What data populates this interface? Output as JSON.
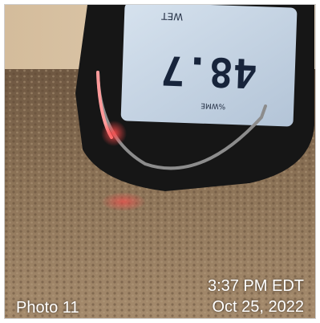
{
  "photo": {
    "label": "Photo 11",
    "time": "3:37 PM EDT",
    "date": "Oct 25, 2022",
    "meter_reading": "48.7",
    "meter_top_text": "WET",
    "meter_unit_text": "%WME"
  },
  "colors": {
    "carpet": "#8c7357",
    "wall": "#d8c3a5",
    "device_body": "#161616",
    "display": "#c4d2e1",
    "digits": "#17243b",
    "led_red": "#ff3a3a"
  }
}
